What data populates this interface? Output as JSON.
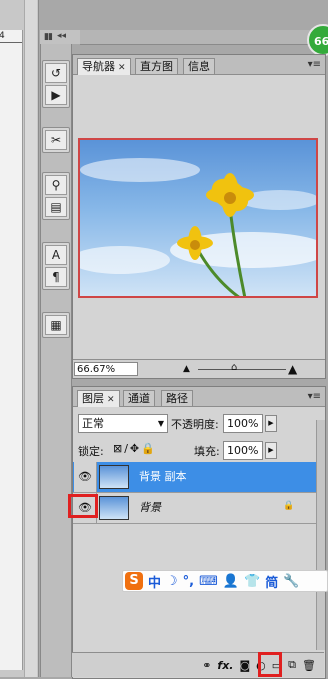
{
  "ruler": {
    "number": "4"
  },
  "topbar": {
    "arrows": "◂◂",
    "badge": "66"
  },
  "tools": {
    "group1": [
      "history-brush",
      "play-action"
    ],
    "group2": [
      "tools"
    ],
    "group3": [
      "clone-source",
      "brush-preset"
    ],
    "group4": [
      "character",
      "paragraph"
    ],
    "group5": [
      "notes"
    ]
  },
  "navigator": {
    "tabs": [
      {
        "label": "导航器",
        "close": "✕"
      },
      {
        "label": "直方图"
      },
      {
        "label": "信息"
      }
    ],
    "zoom": "66.67%"
  },
  "layers_panel": {
    "tabs": [
      {
        "label": "图层",
        "close": "✕"
      },
      {
        "label": "通道"
      },
      {
        "label": "路径"
      }
    ],
    "blend_mode": "正常",
    "opacity_label": "不透明度:",
    "opacity_value": "100%",
    "lock_label": "锁定:",
    "fill_label": "填充:",
    "fill_value": "100%",
    "layers": [
      {
        "name": "背景 副本",
        "selected": true
      },
      {
        "name": "背景",
        "locked": true
      }
    ]
  },
  "ime": {
    "logo": "S",
    "mode": "中",
    "moon": "☽",
    "punct": "°,",
    "simplified": "简"
  },
  "bottom_icons": [
    "link-icon",
    "fx-icon",
    "mask-icon",
    "adjustment-icon",
    "group-icon",
    "new-layer-icon",
    "trash-icon"
  ],
  "bottom_fx": "fx."
}
